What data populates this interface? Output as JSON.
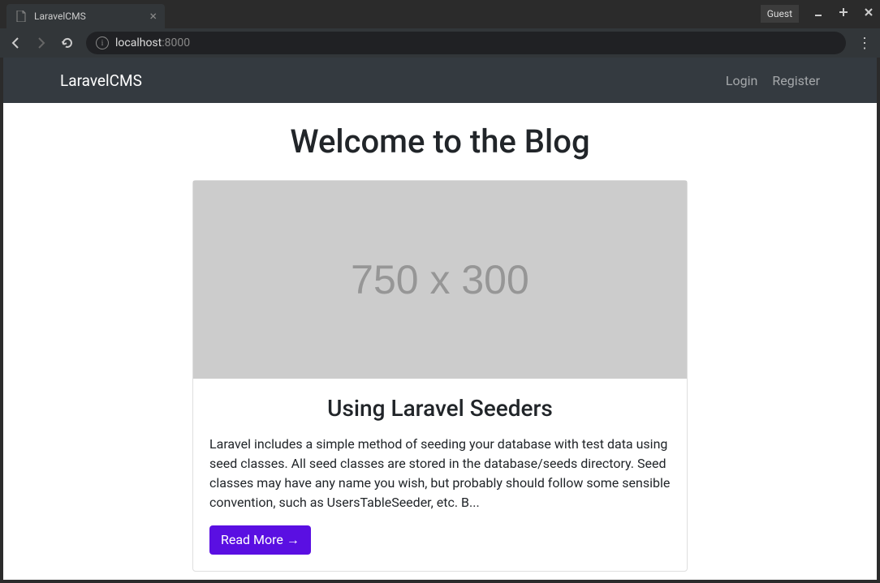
{
  "browser": {
    "tab_title": "LaravelCMS",
    "guest_label": "Guest",
    "url_host": "localhost",
    "url_port": ":8000"
  },
  "navbar": {
    "brand": "LaravelCMS",
    "login_label": "Login",
    "register_label": "Register"
  },
  "page": {
    "title": "Welcome to the Blog"
  },
  "post": {
    "placeholder_text": "750 x 300",
    "title": "Using Laravel Seeders",
    "excerpt": "Laravel includes a simple method of seeding your database with test data using seed classes. All seed classes are stored in the database/seeds directory. Seed classes may have any name you wish, but probably should follow some sensible convention, such as UsersTableSeeder, etc. B...",
    "read_more_label": "Read More →"
  }
}
